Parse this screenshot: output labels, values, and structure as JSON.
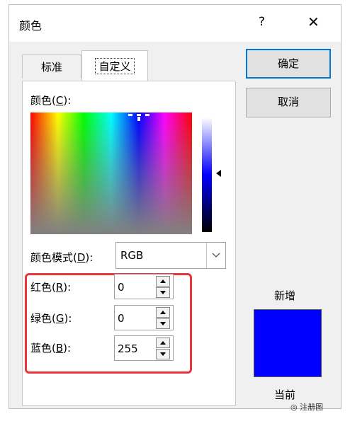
{
  "dialog": {
    "title": "颜色",
    "help_glyph": "?",
    "close_glyph": "✕",
    "tabs": [
      {
        "label": "标准",
        "active": false
      },
      {
        "label": "自定义",
        "active": true
      }
    ],
    "ok_label": "确定",
    "cancel_label": "取消"
  },
  "custom": {
    "colors_label_prefix": "颜色(",
    "colors_label_key": "C",
    "colors_label_suffix": "):",
    "color_mode_label_prefix": "颜色模式(",
    "color_mode_label_key": "D",
    "color_mode_label_suffix": "):",
    "color_mode_value": "RGB",
    "channels": [
      {
        "prefix": "红色(",
        "key": "R",
        "suffix": "):",
        "value": "0"
      },
      {
        "prefix": "绿色(",
        "key": "G",
        "suffix": "):",
        "value": "0"
      },
      {
        "prefix": "蓝色(",
        "key": "B",
        "suffix": "):",
        "value": "255"
      }
    ],
    "preview_new_label": "新增",
    "preview_current_label": "当前",
    "preview_color": "#0000ff"
  },
  "watermark": {
    "text": "注册图"
  },
  "colors": {
    "highlight_frame": "#e8363a",
    "default_button_border": "#0078d7"
  }
}
